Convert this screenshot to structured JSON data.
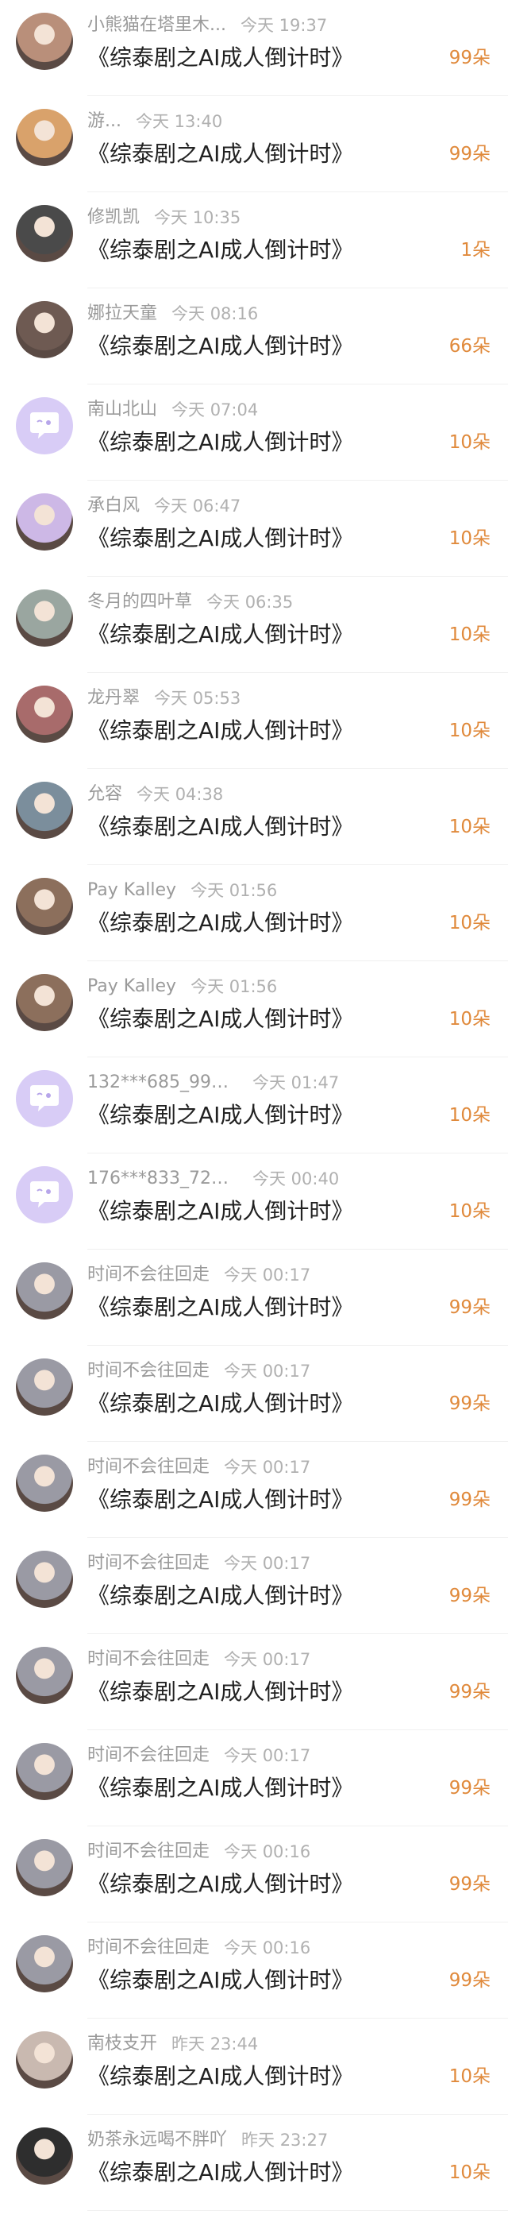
{
  "title_text": "《综泰剧之AI成人倒计时》",
  "items": [
    {
      "name": "小熊猫在塔里木...",
      "time": "今天 19:37",
      "gift": "99朵",
      "avatar": "photo",
      "color": "#b98f7a"
    },
    {
      "name": "游...",
      "time": "今天 13:40",
      "gift": "99朵",
      "avatar": "photo",
      "color": "#d9a26b"
    },
    {
      "name": "修凯凯",
      "time": "今天 10:35",
      "gift": "1朵",
      "avatar": "photo",
      "color": "#4a4a4a"
    },
    {
      "name": "娜拉天童",
      "time": "今天 08:16",
      "gift": "66朵",
      "avatar": "photo",
      "color": "#6e5a52"
    },
    {
      "name": "南山北山",
      "time": "今天 07:04",
      "gift": "10朵",
      "avatar": "default",
      "color": "#d8ccf6"
    },
    {
      "name": "承白风",
      "time": "今天 06:47",
      "gift": "10朵",
      "avatar": "photo",
      "color": "#cdb8e6"
    },
    {
      "name": "冬月的四叶草",
      "time": "今天 06:35",
      "gift": "10朵",
      "avatar": "photo",
      "color": "#9aa6a0"
    },
    {
      "name": "龙丹翠",
      "time": "今天 05:53",
      "gift": "10朵",
      "avatar": "photo",
      "color": "#a86b6b"
    },
    {
      "name": "允容",
      "time": "今天 04:38",
      "gift": "10朵",
      "avatar": "photo",
      "color": "#7b8e9c"
    },
    {
      "name": "Pay Kalley",
      "time": "今天 01:56",
      "gift": "10朵",
      "avatar": "photo",
      "color": "#8c6f5c"
    },
    {
      "name": "Pay Kalley",
      "time": "今天 01:56",
      "gift": "10朵",
      "avatar": "photo",
      "color": "#8c6f5c"
    },
    {
      "name": "132***685_992...",
      "time": "今天 01:47",
      "gift": "10朵",
      "avatar": "default",
      "color": "#d8ccf6"
    },
    {
      "name": "176***833_725...",
      "time": "今天 00:40",
      "gift": "10朵",
      "avatar": "default",
      "color": "#d8ccf6"
    },
    {
      "name": "时间不会往回走",
      "time": "今天 00:17",
      "gift": "99朵",
      "avatar": "photo",
      "color": "#9a9aa4"
    },
    {
      "name": "时间不会往回走",
      "time": "今天 00:17",
      "gift": "99朵",
      "avatar": "photo",
      "color": "#9a9aa4"
    },
    {
      "name": "时间不会往回走",
      "time": "今天 00:17",
      "gift": "99朵",
      "avatar": "photo",
      "color": "#9a9aa4"
    },
    {
      "name": "时间不会往回走",
      "time": "今天 00:17",
      "gift": "99朵",
      "avatar": "photo",
      "color": "#9a9aa4"
    },
    {
      "name": "时间不会往回走",
      "time": "今天 00:17",
      "gift": "99朵",
      "avatar": "photo",
      "color": "#9a9aa4"
    },
    {
      "name": "时间不会往回走",
      "time": "今天 00:17",
      "gift": "99朵",
      "avatar": "photo",
      "color": "#9a9aa4"
    },
    {
      "name": "时间不会往回走",
      "time": "今天 00:16",
      "gift": "99朵",
      "avatar": "photo",
      "color": "#9a9aa4"
    },
    {
      "name": "时间不会往回走",
      "time": "今天 00:16",
      "gift": "99朵",
      "avatar": "photo",
      "color": "#9a9aa4"
    },
    {
      "name": "南枝支开",
      "time": "昨天 23:44",
      "gift": "10朵",
      "avatar": "photo",
      "color": "#c9b9b0"
    },
    {
      "name": "奶茶永远喝不胖吖",
      "time": "昨天 23:27",
      "gift": "10朵",
      "avatar": "photo",
      "color": "#2e2e2e"
    }
  ]
}
